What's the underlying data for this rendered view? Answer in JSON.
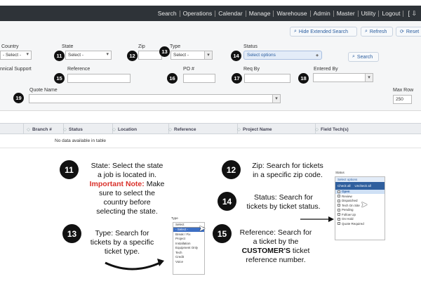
{
  "nav": {
    "items": [
      "Search",
      "Operations",
      "Calendar",
      "Manage",
      "Warehouse",
      "Admin",
      "Master",
      "Utility",
      "Logout"
    ],
    "extra": "[ ⇩"
  },
  "toolbar": {
    "hide_extended": "Hide Extended Search",
    "refresh": "Refresh",
    "reset": "Reset"
  },
  "form": {
    "country_label": "Country",
    "country_value": "- Select -",
    "state_label": "State",
    "state_value": "Select -",
    "zip_label": "Zip",
    "type_label": "Type",
    "type_value": "Select -",
    "status_label": "Status",
    "status_value": "Select options",
    "search_button": "Search",
    "support_label": "nnical Support",
    "reference_label": "Reference",
    "po_label": "PO #",
    "reqby_label": "Req By",
    "enteredby_label": "Entered By",
    "quote_label": "Quote Name",
    "maxrow_label": "Max Row",
    "maxrow_value": "250"
  },
  "badges": [
    "11",
    "12",
    "13",
    "14",
    "15",
    "16",
    "17",
    "18",
    "19"
  ],
  "grid": {
    "columns": [
      "Branch #",
      "Status",
      "Location",
      "Reference",
      "Project Name",
      "Field Tech(s)"
    ],
    "empty_message": "No data available in table"
  },
  "notes": {
    "state_num": "11",
    "state_l1": "State: Select the state",
    "state_l2": "a job is located in.",
    "state_important": "Important Note:",
    "state_l3": " Make",
    "state_l4": "sure to select the",
    "state_l5": "country before",
    "state_l6": "selecting the state.",
    "zip_num": "12",
    "zip_l1": "Zip: Search for tickets",
    "zip_l2": "in a specific zip code.",
    "status_num": "14",
    "status_l1": "Status: Search for",
    "status_l2": "tickets by ticket status.",
    "type_num": "13",
    "type_l1": "Type: Search for",
    "type_l2": "tickets by a specific",
    "type_l3": "ticket type.",
    "ref_num": "15",
    "ref_l1": "Reference: Search for",
    "ref_l2": "a ticket by the",
    "ref_customer": "CUSTOMER'S",
    "ref_l3": " ticket",
    "ref_l4": "reference number."
  },
  "type_inset": {
    "label": "Type",
    "select_value": "Select",
    "options": [
      "- Select -",
      "Break / Fix",
      "Project",
      "Installation",
      "Equipment Only",
      "Tech",
      "Credit",
      "Voice"
    ]
  },
  "status_inset": {
    "label": "Status",
    "placeholder": "Select options",
    "check_all": "Check all",
    "uncheck_all": "Uncheck all",
    "options": [
      "Open",
      "Review",
      "Dispatched",
      "Tech On Site",
      "Pending",
      "Follow Up",
      "On Hold",
      "Quote Required"
    ]
  },
  "colors": {
    "navbar": "#2e3338",
    "accent": "#2a5d9f",
    "important": "#d9312b"
  }
}
